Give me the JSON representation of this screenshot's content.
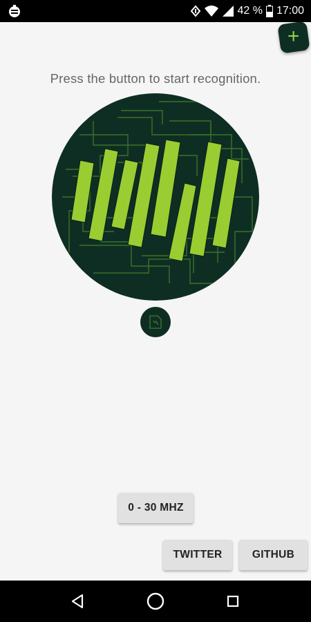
{
  "status_bar": {
    "battery_percent": "42 %",
    "time": "17:00",
    "icons": [
      "app-notification-icon",
      "vibrate-icon",
      "wifi-icon",
      "cell-signal-icon",
      "battery-icon"
    ]
  },
  "fab": {
    "label": "+",
    "icon": "plus-icon"
  },
  "main": {
    "instruction": "Press the button to start recognition.",
    "recognize_button": {
      "icon": "waveform-circuit-icon",
      "bar_color": "#9acd32",
      "background": "#0f2e23"
    },
    "mini_button": {
      "icon": "spectrum-icon"
    }
  },
  "buttons": {
    "frequency_range": "0 - 30 MHZ",
    "twitter": "TWITTER",
    "github": "GITHUB"
  },
  "nav_bar": {
    "icons": [
      "back-icon",
      "home-icon",
      "recents-icon"
    ]
  },
  "colors": {
    "accent_dark": "#0f2e23",
    "accent_green": "#9acd32",
    "background": "#f5f5f5"
  }
}
